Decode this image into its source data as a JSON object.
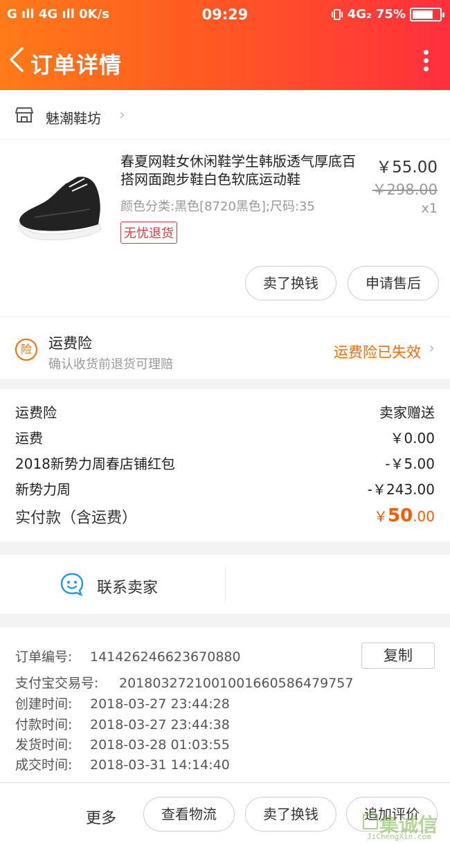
{
  "status_bar": {
    "left": "G ıll 4G ıll 0K/s",
    "time": "09:29",
    "network": "4G₂",
    "battery": "75%",
    "battery_level": 0.75
  },
  "header": {
    "title": "订单详情",
    "back_icon": "chevron-left-icon",
    "more_icon": "more-vertical-icon"
  },
  "shop": {
    "name": "魅潮鞋坊",
    "icon": "store-icon"
  },
  "product": {
    "title": "春夏网鞋女休闲鞋学生韩版透气厚底百搭网面跑步鞋白色软底运动鞋",
    "spec": "颜色分类:黑色[8720黑色];尺码:35",
    "tag": "无忧退货",
    "price": "￥55.00",
    "original_price": "￥298.00",
    "quantity": "x1",
    "actions": [
      "卖了换钱",
      "申请售后"
    ]
  },
  "insurance": {
    "title": "运费险",
    "subtitle": "确认收货前退货可理赔",
    "badge": "险",
    "status": "运费险已失效"
  },
  "fees": [
    {
      "label": "运费险",
      "value": "卖家赠送"
    },
    {
      "label": "运费",
      "value": "￥0.00"
    },
    {
      "label": "2018新势力周春店铺红包",
      "value": "-￥5.00"
    },
    {
      "label": "新势力周",
      "value": "-￥243.00"
    }
  ],
  "total": {
    "label": "实付款（含运费）",
    "currency": "￥",
    "integer": "50",
    "decimal": ".00"
  },
  "contact": {
    "label": "联系卖家",
    "icon": "chat-bubble-icon"
  },
  "order_info": {
    "copy_label": "复制",
    "rows": [
      {
        "label": "订单编号:",
        "value": "141426246623670880"
      },
      {
        "label": "支付宝交易号:",
        "value": "2018032721001001660586479757"
      },
      {
        "label": "创建时间:",
        "value": "2018-03-27 23:44:28"
      },
      {
        "label": "付款时间:",
        "value": "2018-03-27 23:44:38"
      },
      {
        "label": "发货时间:",
        "value": "2018-03-28 01:03:55"
      },
      {
        "label": "成交时间:",
        "value": "2018-03-31 14:14:40"
      }
    ]
  },
  "bottom_bar": {
    "more": "更多",
    "buttons": [
      "查看物流",
      "卖了换钱",
      "追加评价"
    ]
  },
  "watermark": {
    "text": "集诚信",
    "sub": "JiChengXin.com"
  },
  "colors": {
    "accent": "#ff5a22",
    "price_orange": "#ff5a00",
    "red_tag": "#e4393c"
  }
}
